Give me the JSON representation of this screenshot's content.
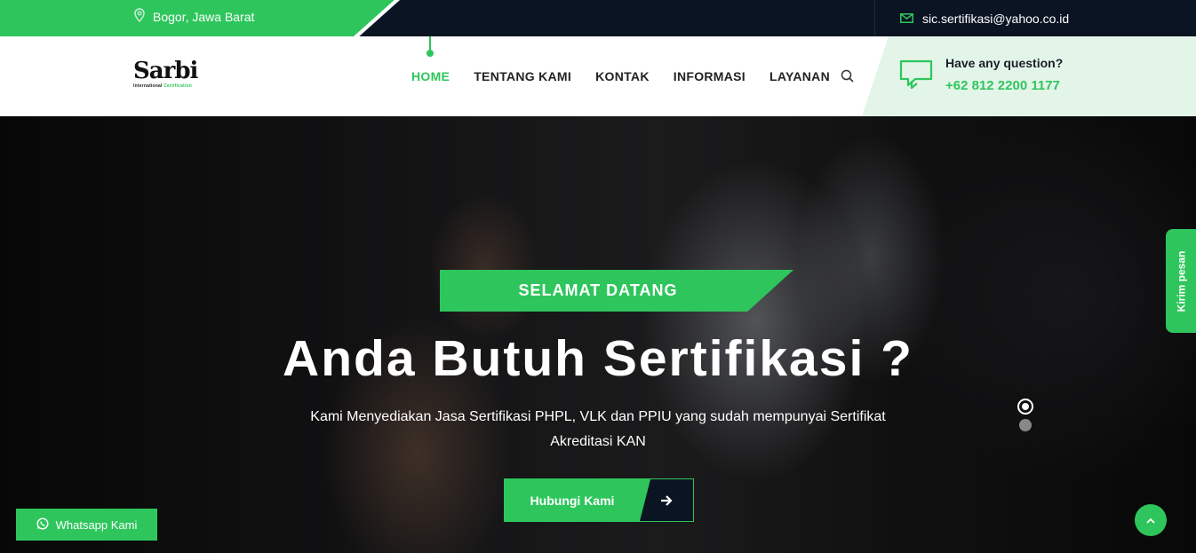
{
  "topbar": {
    "location": "Bogor, Jawa Barat",
    "email": "sic.sertifikasi@yahoo.co.id",
    "location_icon": "map-pin-icon",
    "email_icon": "envelope-icon"
  },
  "header": {
    "logo_text": "Sarbi",
    "logo_sub_left": "International",
    "logo_sub_right": "Certification",
    "nav": [
      {
        "label": "HOME",
        "active": true
      },
      {
        "label": "TENTANG KAMI",
        "active": false
      },
      {
        "label": "KONTAK",
        "active": false
      },
      {
        "label": "INFORMASI",
        "active": false
      },
      {
        "label": "LAYANAN",
        "active": false
      }
    ],
    "question_title": "Have any question?",
    "question_phone": "+62 812 2200 1177"
  },
  "hero": {
    "badge": "SELAMAT DATANG",
    "title": "Anda Butuh Sertifikasi ?",
    "subtitle": "Kami Menyediakan Jasa Sertifikasi PHPL, VLK dan PPIU yang sudah mempunyai Sertifikat Akreditasi KAN",
    "cta_label": "Hubungi Kami"
  },
  "floating": {
    "kirim_label": "Kirim pesan",
    "whatsapp_label": "Whatsapp Kami"
  },
  "colors": {
    "accent": "#2ec65c",
    "dark": "#0b1423",
    "light_green": "#e3f5e8"
  }
}
